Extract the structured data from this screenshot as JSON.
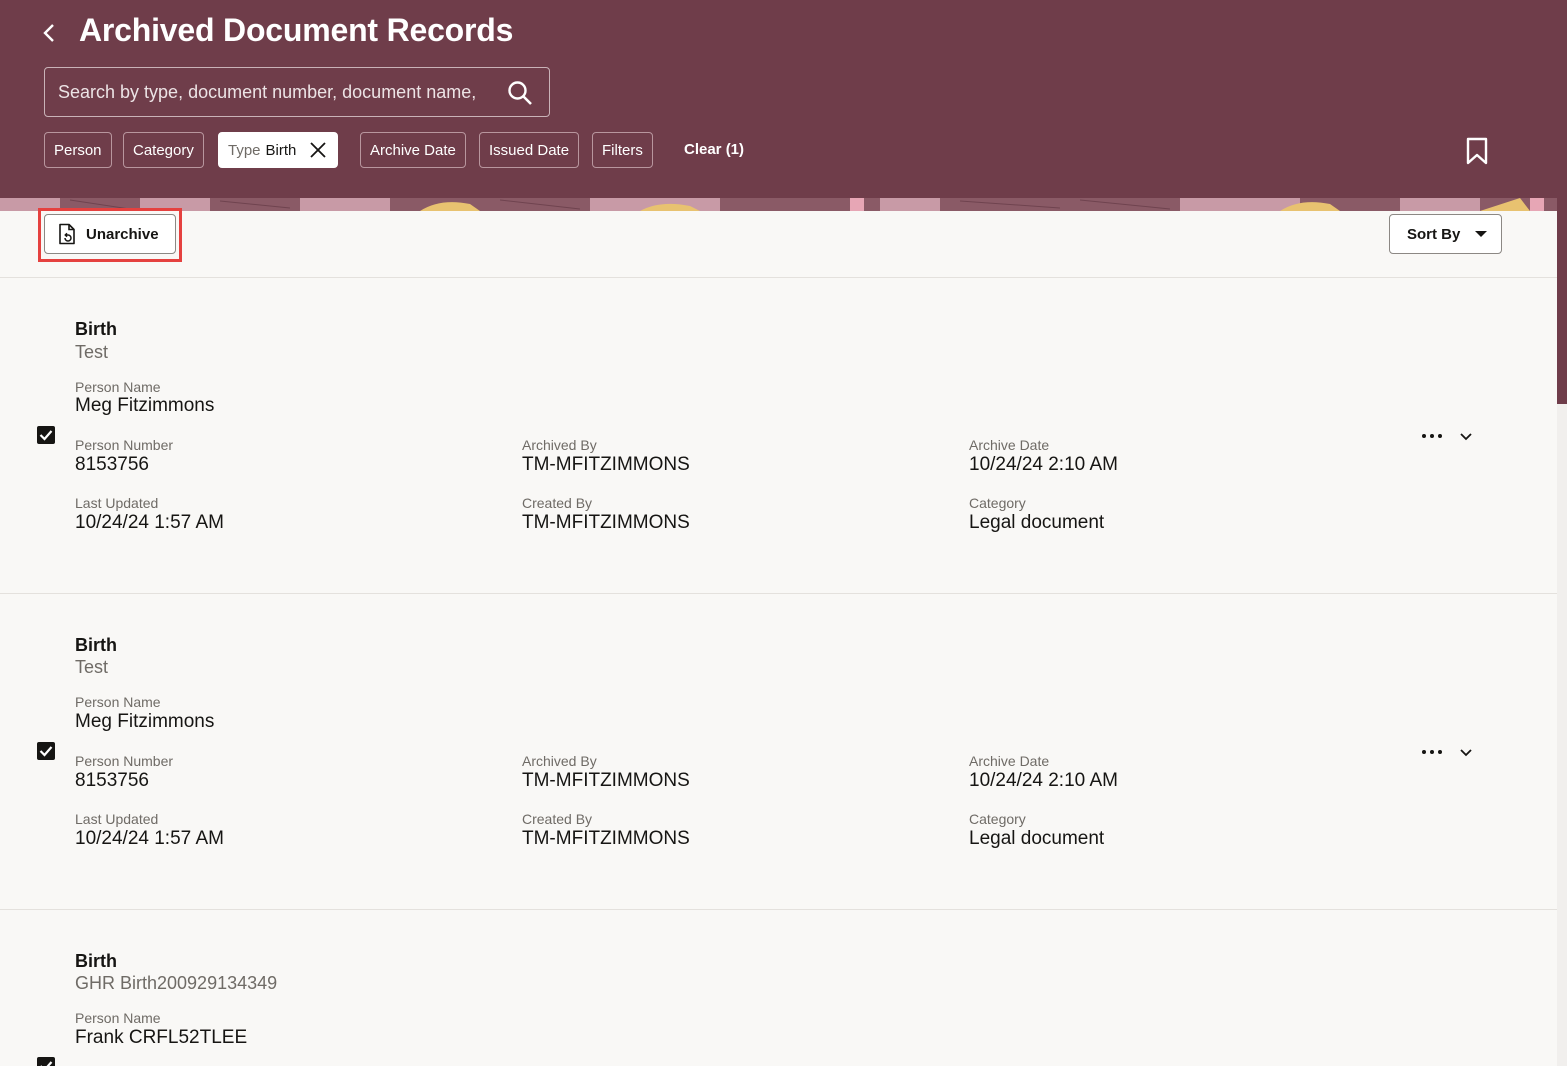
{
  "header": {
    "title": "Archived Document Records",
    "search_placeholder": "Search by type, document number, document name,",
    "filters": {
      "person": "Person",
      "category": "Category",
      "type_label": "Type",
      "type_value": "Birth",
      "archive_date": "Archive Date",
      "issued_date": "Issued Date",
      "filters": "Filters",
      "clear": "Clear (1)"
    },
    "accent_color": "#6f3d4a"
  },
  "toolbar": {
    "unarchive_label": "Unarchive",
    "sort_label": "Sort By"
  },
  "records": [
    {
      "title": "Birth",
      "subtitle": "Test",
      "checked": true,
      "person_name_label": "Person Name",
      "person_name": "Meg Fitzimmons",
      "person_number_label": "Person Number",
      "person_number": "8153756",
      "archived_by_label": "Archived By",
      "archived_by": "TM-MFITZIMMONS",
      "archive_date_label": "Archive Date",
      "archive_date": "10/24/24 2:10 AM",
      "last_updated_label": "Last Updated",
      "last_updated": "10/24/24 1:57 AM",
      "created_by_label": "Created By",
      "created_by": "TM-MFITZIMMONS",
      "category_label": "Category",
      "category": "Legal document"
    },
    {
      "title": "Birth",
      "subtitle": "Test",
      "checked": true,
      "person_name_label": "Person Name",
      "person_name": "Meg Fitzimmons",
      "person_number_label": "Person Number",
      "person_number": "8153756",
      "archived_by_label": "Archived By",
      "archived_by": "TM-MFITZIMMONS",
      "archive_date_label": "Archive Date",
      "archive_date": "10/24/24 2:10 AM",
      "last_updated_label": "Last Updated",
      "last_updated": "10/24/24 1:57 AM",
      "created_by_label": "Created By",
      "created_by": "TM-MFITZIMMONS",
      "category_label": "Category",
      "category": "Legal document"
    },
    {
      "title": "Birth",
      "subtitle": "GHR Birth200929134349",
      "checked": true,
      "person_name_label": "Person Name",
      "person_name": "Frank CRFL52TLEE"
    }
  ]
}
